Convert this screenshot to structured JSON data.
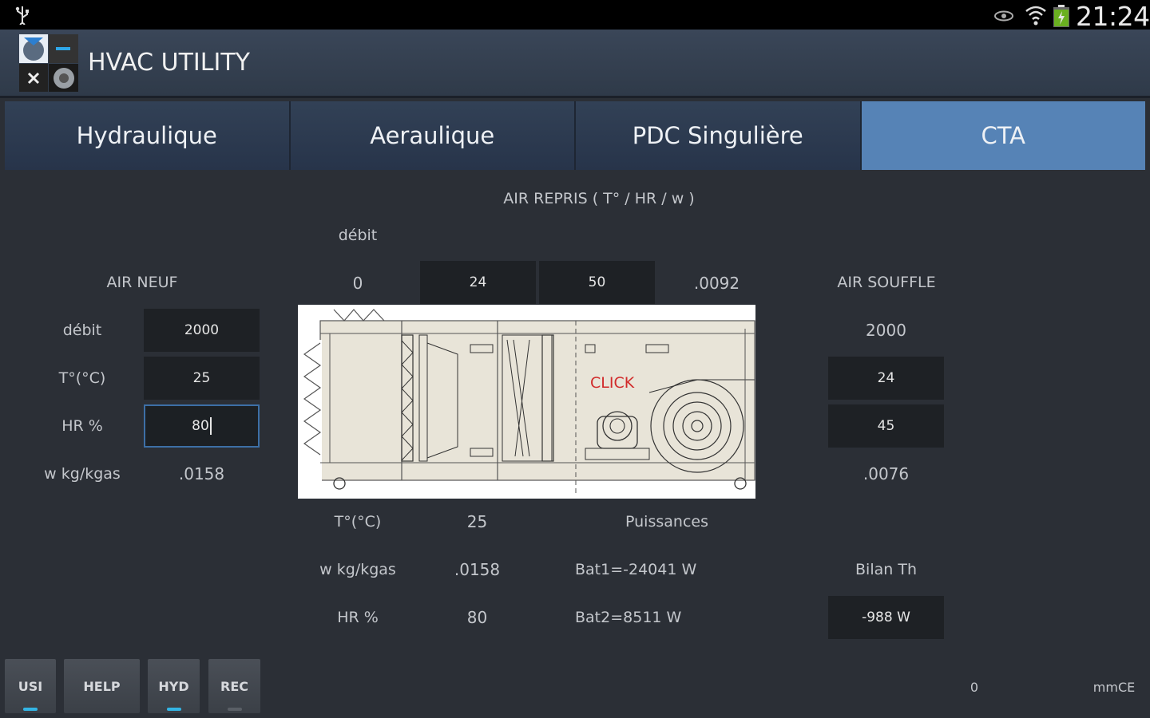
{
  "status": {
    "time": "21:24"
  },
  "app": {
    "title": "HVAC UTILITY"
  },
  "tabs": [
    {
      "label": "Hydraulique"
    },
    {
      "label": "Aeraulique"
    },
    {
      "label": "PDC Singulière"
    },
    {
      "label": "CTA"
    }
  ],
  "air_repris": {
    "header": "AIR REPRIS ( T° / HR / w )",
    "debit_label": "débit",
    "debit_value": "0",
    "temp": "24",
    "hr": "50",
    "w": ".0092"
  },
  "air_neuf": {
    "title": "AIR NEUF",
    "debit_label": "débit",
    "debit_value": "2000",
    "temp_label": "T°(°C)",
    "temp_value": "25",
    "hr_label": "HR %",
    "hr_value": "80",
    "w_label": "w kg/kgas",
    "w_value": ".0158"
  },
  "air_souffle": {
    "title": "AIR SOUFFLE",
    "debit_value": "2000",
    "temp_value": "24",
    "hr_value": "45",
    "w_value": ".0076"
  },
  "mix": {
    "temp_label": "T°(°C)",
    "temp_value": "25",
    "w_label": "w kg/kgas",
    "w_value": ".0158",
    "hr_label": "HR %",
    "hr_value": "80"
  },
  "puissances": {
    "title": "Puissances",
    "bat1": "Bat1=-24041 W",
    "bat2": "Bat2=8511 W"
  },
  "bilan": {
    "title": "Bilan Th",
    "value": "-988 W"
  },
  "diagram": {
    "click_label": "CLICK"
  },
  "bottom": {
    "buttons": [
      {
        "label": "USI",
        "indicator": "on"
      },
      {
        "label": "HELP",
        "indicator": "none"
      },
      {
        "label": "HYD",
        "indicator": "on"
      },
      {
        "label": "REC",
        "indicator": "off"
      }
    ],
    "pressure_value": "0",
    "pressure_unit": "mmCE"
  },
  "colors": {
    "accent": "#33b5e5",
    "tab_active": "#5683b6",
    "field_bg": "#1e2125",
    "background": "#2b2f36"
  }
}
